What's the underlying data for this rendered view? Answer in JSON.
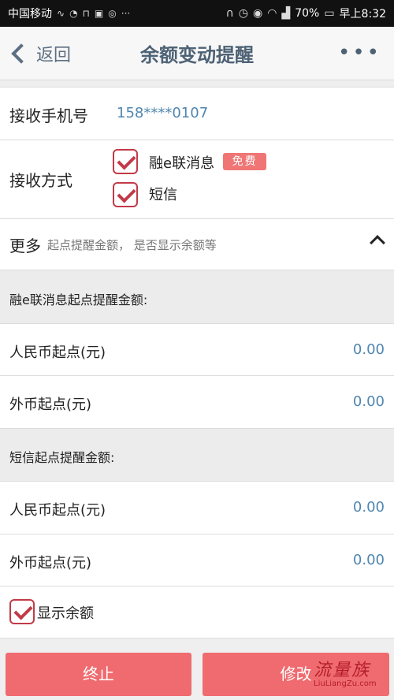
{
  "status_bar": {
    "carrier": "中国移动",
    "battery": "70%",
    "time": "早上8:32",
    "left_icons": [
      "activity-icon",
      "wechat-icon",
      "lock-icon",
      "news-icon",
      "app-icon",
      "ellipsis-icon"
    ],
    "right_icons": [
      "headphones-icon",
      "alarm-icon",
      "eye-icon",
      "wifi-icon",
      "signal-4g-icon",
      "battery-icon"
    ]
  },
  "header": {
    "back_label": "返回",
    "title": "余额变动提醒",
    "more_icon": "more-icon"
  },
  "phone_row": {
    "label": "接收手机号",
    "value": "158****0107"
  },
  "receive_method": {
    "label": "接收方式",
    "options": [
      {
        "label": "融e联消息",
        "checked": true,
        "badge": "免费"
      },
      {
        "label": "短信",
        "checked": true
      }
    ]
  },
  "more": {
    "label": "更多",
    "sub": "起点提醒金额， 是否显示余额等",
    "icon": "chevron-up-icon"
  },
  "sections": [
    {
      "title": "融e联消息起点提醒金额:",
      "rows": [
        {
          "label": "人民币起点(元)",
          "value": "0.00"
        },
        {
          "label": "外币起点(元)",
          "value": "0.00"
        }
      ]
    },
    {
      "title": "短信起点提醒金额:",
      "rows": [
        {
          "label": "人民币起点(元)",
          "value": "0.00"
        },
        {
          "label": "外币起点(元)",
          "value": "0.00"
        }
      ]
    }
  ],
  "show_balance": {
    "label": "显示余额",
    "checked": true
  },
  "buttons": {
    "stop": "终止",
    "modify": "修改"
  },
  "watermark": {
    "main": "流量族",
    "sub": "LiuLiangZu.com"
  },
  "colors": {
    "accent": "#c23a48",
    "button": "#ef6b6f",
    "link": "#4f86b0",
    "title": "#4e6275"
  }
}
